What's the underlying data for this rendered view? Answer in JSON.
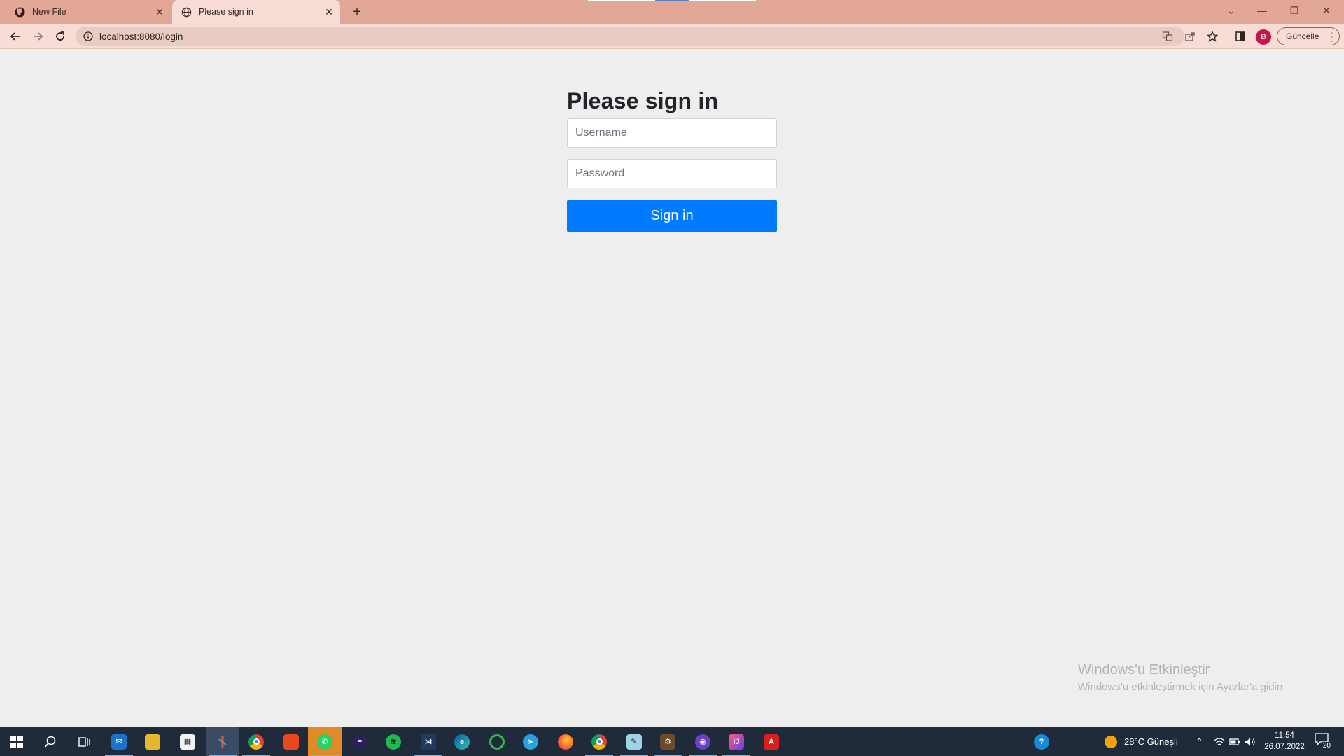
{
  "browser": {
    "tabs": [
      {
        "title": "New File",
        "icon": "github-icon",
        "active": false
      },
      {
        "title": "Please sign in",
        "icon": "globe-icon",
        "active": true
      }
    ],
    "url": "localhost:8080/login",
    "update_label": "Güncelle",
    "profile_initial": "B"
  },
  "page": {
    "heading": "Please sign in",
    "username_placeholder": "Username",
    "password_placeholder": "Password",
    "submit_label": "Sign in"
  },
  "watermark": {
    "title": "Windows'u Etkinleştir",
    "subtitle": "Windows'u etkinleştirmek için Ayarlar'a gidin."
  },
  "taskbar": {
    "weather": "28°C  Güneşli",
    "time": "11:54",
    "date": "26.07.2022",
    "notification_count": "20",
    "apps": [
      "mail",
      "file-explorer",
      "store",
      "app-active",
      "chrome",
      "office",
      "whatsapp",
      "eclipse",
      "spotify",
      "vscode",
      "edge",
      "app-green",
      "telegram",
      "firefox",
      "chrome-profile",
      "notepad",
      "game",
      "github-desktop",
      "intellij",
      "acrobat"
    ]
  },
  "colors": {
    "tabstrip": "#e2a797",
    "toolbar": "#f7ddd5",
    "primary_button": "#007bff",
    "taskbar": "#1f2a3a"
  }
}
